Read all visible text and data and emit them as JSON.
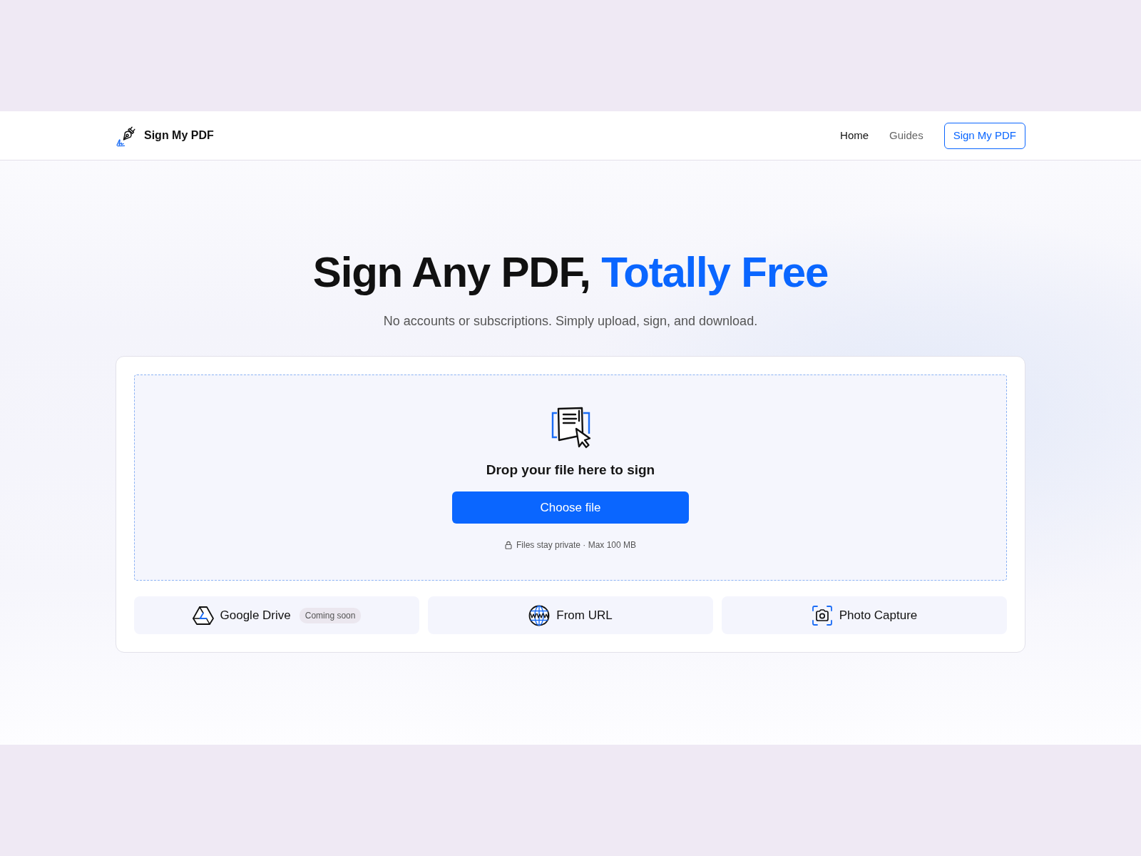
{
  "header": {
    "brand": "Sign My PDF",
    "nav": [
      {
        "label": "Home",
        "selected": true
      },
      {
        "label": "Guides",
        "selected": false
      }
    ],
    "cta": "Sign My PDF"
  },
  "hero": {
    "title": "Sign Any PDF,",
    "title_highlight": "Totally Free",
    "subtitle": "No accounts or subscriptions. Simply upload, sign, and download."
  },
  "upload": {
    "prompt": "Drop your file here to sign",
    "button": "Choose file",
    "note": "Files stay private · Max 100 MB"
  },
  "sources": [
    {
      "kind": "drive",
      "label": "Google Drive",
      "badge": "Coming soon"
    },
    {
      "kind": "url",
      "label": "From URL"
    },
    {
      "kind": "camera",
      "label": "Photo Capture"
    }
  ]
}
